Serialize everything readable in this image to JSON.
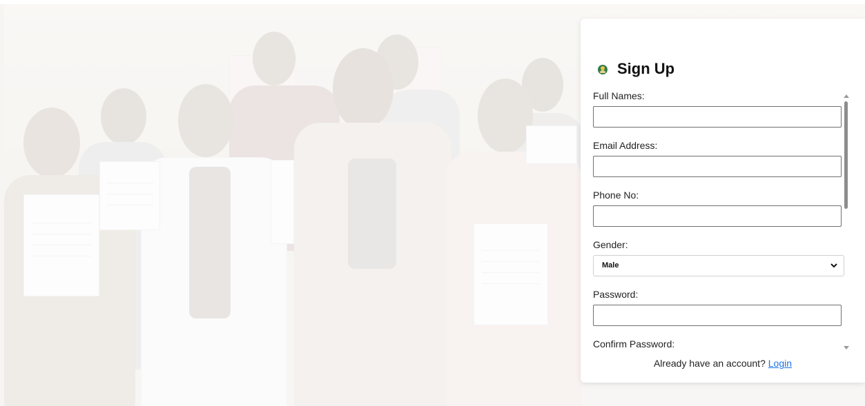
{
  "signup": {
    "title": "Sign Up",
    "logo_icon": "user-avatar-icon",
    "fields": {
      "full_names_label": "Full Names:",
      "full_names_value": "",
      "email_label": "Email Address:",
      "email_value": "",
      "phone_label": "Phone No:",
      "phone_value": "",
      "gender_label": "Gender:",
      "gender_value": "Male",
      "password_label": "Password:",
      "password_value": "",
      "confirm_password_label": "Confirm Password:"
    },
    "footer": {
      "prompt": "Already have an account?",
      "login_label": "Login"
    }
  },
  "colors": {
    "link": "#1a73e8",
    "card_bg": "#ffffff",
    "page_bg": "#f6f5f3"
  }
}
